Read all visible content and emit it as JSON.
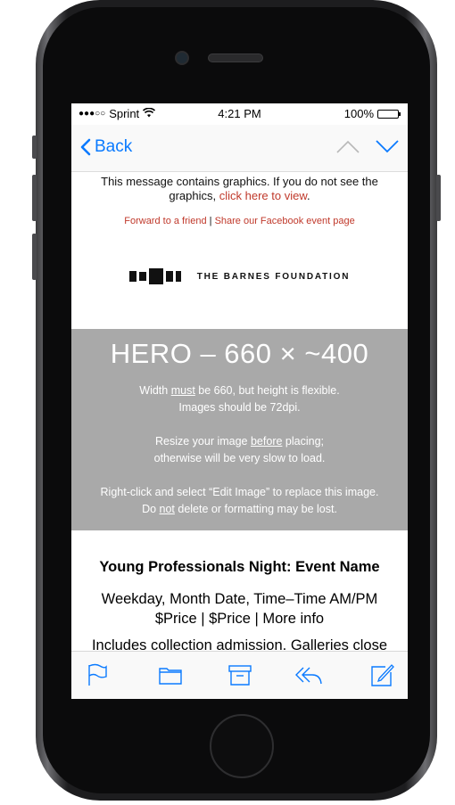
{
  "status_bar": {
    "signal_dots": "●●●○○",
    "carrier": "Sprint",
    "wifi_icon": "wifi-icon",
    "time": "4:21 PM",
    "battery": "100%"
  },
  "nav": {
    "back_label": "Back",
    "prev_icon": "chevron-up-icon",
    "next_icon": "chevron-down-icon"
  },
  "email": {
    "notice_text": "This message contains graphics. If you do not see the graphics,",
    "notice_link": "click here to view",
    "notice_end": ".",
    "forward_link": "Forward to a friend",
    "separator": "|",
    "facebook_link": "Share our Facebook event page",
    "logo_text": "THE BARNES FOUNDATION",
    "hero": {
      "title": "HERO – 660 × ~400",
      "line1_pre": "Width ",
      "line1_u": "must",
      "line1_post": " be 660, but height is flexible.",
      "line2": "Images should be 72dpi.",
      "line3_pre": "Resize your image ",
      "line3_u": "before",
      "line3_post": " placing;",
      "line4": "otherwise will be very slow to load.",
      "line5": "Right-click and select “Edit Image” to replace this image.",
      "line6_pre": "Do ",
      "line6_u": "not",
      "line6_post": " delete or formatting may be lost."
    },
    "event_name": "Young Professionals Night: Event Name",
    "event_when": "Weekday, Month Date, Time–Time AM/PM",
    "event_price": "$Price | $Price | More info",
    "event_more": "Includes collection admission. Galleries close"
  },
  "toolbar": {
    "icons": [
      "flag-icon",
      "folder-icon",
      "archive-icon",
      "reply-icon",
      "compose-icon"
    ]
  },
  "colors": {
    "ios_blue": "#0a7aff",
    "link_red": "#c0392b",
    "hero_gray": "#a9a9a9"
  }
}
